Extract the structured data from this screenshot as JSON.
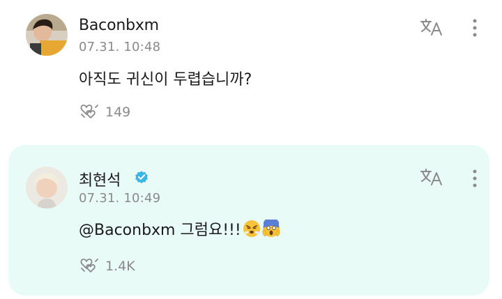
{
  "posts": [
    {
      "username": "Baconbxm",
      "timestamp": "07.31. 10:48",
      "text": "아직도 귀신이 두렵습니까?",
      "likes": "149",
      "verified": false
    },
    {
      "username": "최현석",
      "timestamp": "07.31. 10:49",
      "text": "@Baconbxm 그럼요!!!",
      "likes": "1.4K",
      "verified": true,
      "emojis": [
        "face-with-steam-emoji",
        "face-screaming-in-fear-emoji"
      ]
    }
  ],
  "colors": {
    "reply_background": "#e9fbf7",
    "verified_badge": "#39b6e6",
    "muted_text": "#8a8a8a"
  },
  "icons": {
    "like": "heart-cluster-icon",
    "translate": "translate-icon",
    "more": "more-vertical-icon"
  }
}
